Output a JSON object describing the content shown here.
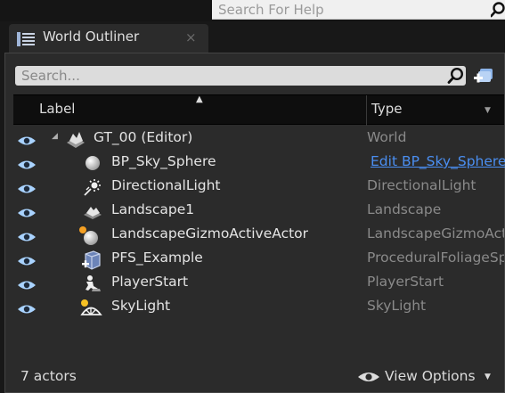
{
  "help": {
    "placeholder": "Search For Help"
  },
  "tab": {
    "title": "World Outliner",
    "close": "×"
  },
  "search": {
    "placeholder": "Search..."
  },
  "header": {
    "label": "Label",
    "type": "Type"
  },
  "rows": [
    {
      "label": "GT_00 (Editor)",
      "type": "World",
      "icon": "world-icon"
    },
    {
      "label": "BP_Sky_Sphere",
      "type": "Edit BP_Sky_Sphere",
      "icon": "sphere-icon"
    },
    {
      "label": "DirectionalLight",
      "type": "DirectionalLight",
      "icon": "directional-light-icon"
    },
    {
      "label": "Landscape1",
      "type": "Landscape",
      "icon": "landscape-icon"
    },
    {
      "label": "LandscapeGizmoActiveActor",
      "type": "LandscapeGizmoActiveActor",
      "icon": "gizmo-icon"
    },
    {
      "label": "PFS_Example",
      "type": "ProceduralFoliageSpawner",
      "icon": "foliage-volume-icon"
    },
    {
      "label": "PlayerStart",
      "type": "PlayerStart",
      "icon": "player-start-icon"
    },
    {
      "label": "SkyLight",
      "type": "SkyLight",
      "icon": "sky-light-icon"
    }
  ],
  "footer": {
    "count": "7 actors",
    "view_options": "View Options"
  },
  "colors": {
    "link": "#4a8ef0",
    "panel": "#2b2b2b",
    "header": "#0e0e0e",
    "eye": "#a9d3ff"
  }
}
